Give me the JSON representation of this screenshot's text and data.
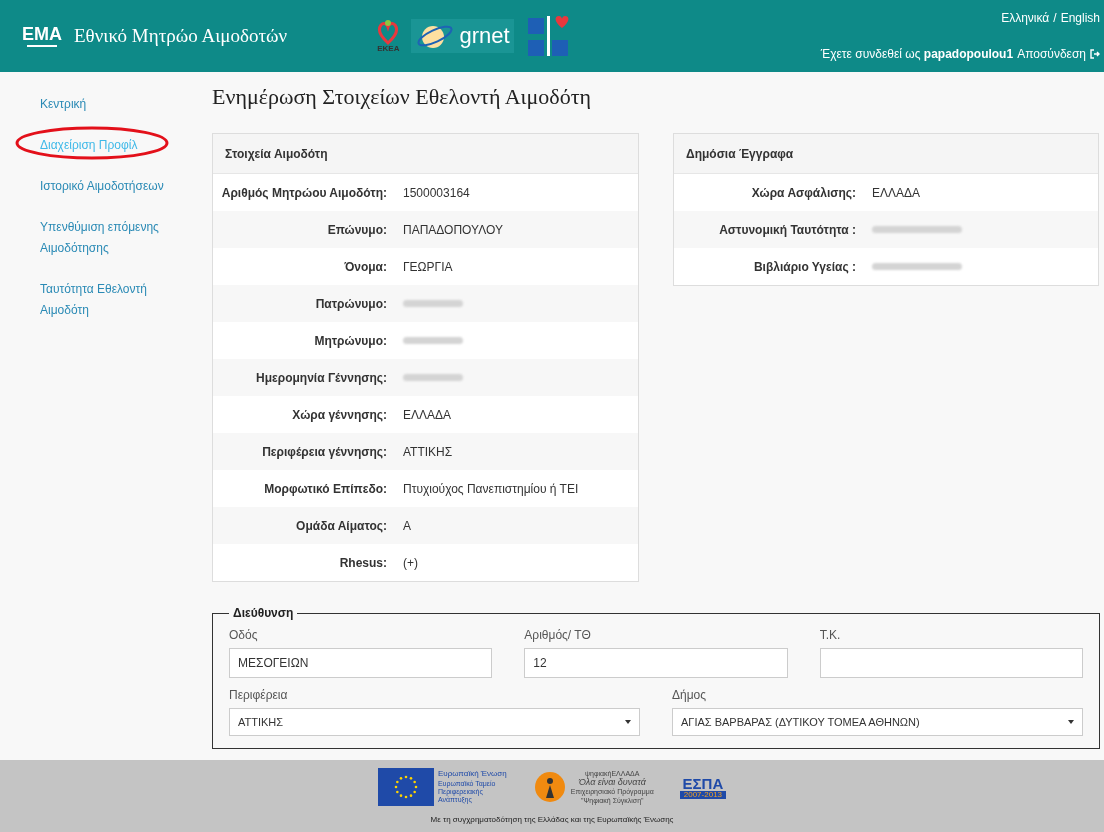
{
  "header": {
    "logo_text": "EMA",
    "title": "Εθνικό Μητρώο Αιμοδοτών",
    "partner_logos": [
      {
        "kind": "ekea",
        "text": "ΕΚΕΑ"
      },
      {
        "kind": "grnet",
        "text": "grnet"
      },
      {
        "kind": "medical"
      }
    ],
    "languages": [
      "Ελληνικά",
      "English"
    ],
    "language_separator": "/",
    "login_text": "Έχετε συνδεθεί ως **papadopoulou1**",
    "logout": "Αποσύνδεση"
  },
  "sidebar": {
    "items": [
      {
        "label": "Κεντρική",
        "selected": false,
        "circled": false
      },
      {
        "label": "Διαχείριση Προφίλ",
        "selected": true,
        "circled": true
      },
      {
        "label": "Ιστορικό Αιμοδοτήσεων",
        "selected": false,
        "circled": false
      },
      {
        "label": "Υπενθύμιση επόμενης Αιμοδότησης",
        "selected": false,
        "circled": false
      },
      {
        "label": "Ταυτότητα Εθελοντή Αιμοδότη",
        "selected": false,
        "circled": false
      }
    ]
  },
  "page_title": "Ενημέρωση Στοιχείων Εθελοντή Αιμοδότη",
  "donor_panel": {
    "title": "Στοιχεία Αιμοδότη",
    "rows": [
      {
        "label": "Αριθμός Μητρώου Αιμοδότη:",
        "value": "1500003164",
        "redacted": false
      },
      {
        "label": "Επώνυμο:",
        "value": "ΠΑΠΑΔΟΠΟΥΛΟΥ",
        "redacted": false
      },
      {
        "label": "Όνομα:",
        "value": "ΓΕΩΡΓΙΑ",
        "redacted": false
      },
      {
        "label": "Πατρώνυμο:",
        "redacted": true
      },
      {
        "label": "Μητρώνυμο:",
        "redacted": true
      },
      {
        "label": "Ημερομηνία Γέννησης:",
        "redacted": true
      },
      {
        "label": "Χώρα γέννησης:",
        "value": "ΕΛΛΑΔΑ",
        "redacted": false
      },
      {
        "label": "Περιφέρεια γέννησης:",
        "value": "ΑΤΤΙΚΗΣ",
        "redacted": false
      },
      {
        "label": "Μορφωτικό Επίπεδο:",
        "value": "Πτυχιούχος Πανεπιστημίου ή ΤΕΙ",
        "redacted": false
      },
      {
        "label": "Ομάδα Αίματος:",
        "value": "Α",
        "redacted": false
      },
      {
        "label": "Rhesus:",
        "value": "(+)",
        "redacted": false
      }
    ]
  },
  "documents_panel": {
    "title": "Δημόσια Έγγραφα",
    "rows": [
      {
        "label": "Χώρα Ασφάλισης:",
        "value": "ΕΛΛΑΔΑ",
        "redacted": false
      },
      {
        "label": "Αστυνομική Ταυτότητα :",
        "redacted": true
      },
      {
        "label": "Βιβλιάριο Υγείας :",
        "redacted": true
      }
    ]
  },
  "address": {
    "legend": "Διεύθυνση",
    "fields": [
      {
        "label": "Οδός",
        "value": "ΜΕΣΟΓΕΙΩΝ",
        "kind": "text"
      },
      {
        "label": "Αριθμός/ ΤΘ",
        "value": "12",
        "kind": "text"
      },
      {
        "label": "Τ.Κ.",
        "kind": "text"
      },
      {
        "label": "Περιφέρεια",
        "value": "ΑΤΤΙΚΗΣ",
        "kind": "select"
      },
      {
        "label": "Δήμος",
        "value": "ΑΓΙΑΣ ΒΑΡΒΑΡΑΣ (ΔΥΤΙΚΟΥ ΤΟΜΕΑ ΑΘΗΝΩΝ)",
        "kind": "select"
      }
    ]
  },
  "footer": {
    "logos": [
      {
        "kind": "eu",
        "lines": [
          "Ευρωπαϊκή Ένωση",
          "Ευρωπαϊκό Ταμείο",
          "Περιφερειακής",
          "Ανάπτυξης"
        ]
      },
      {
        "kind": "digital",
        "lines": [
          "ψηφιακήΕΛΛΑΔΑ",
          "Όλα είναι δυνατά",
          "Επιχειρησιακό Πρόγραμμα",
          "\"Ψηφιακή Σύγκλιση\""
        ]
      },
      {
        "kind": "espa",
        "lines": [
          "ΕΣΠΑ",
          "2007-2013"
        ]
      }
    ],
    "caption": "Με τη συγχρηματοδότηση της Ελλάδας και της Ευρωπαϊκής Ένωσης"
  }
}
